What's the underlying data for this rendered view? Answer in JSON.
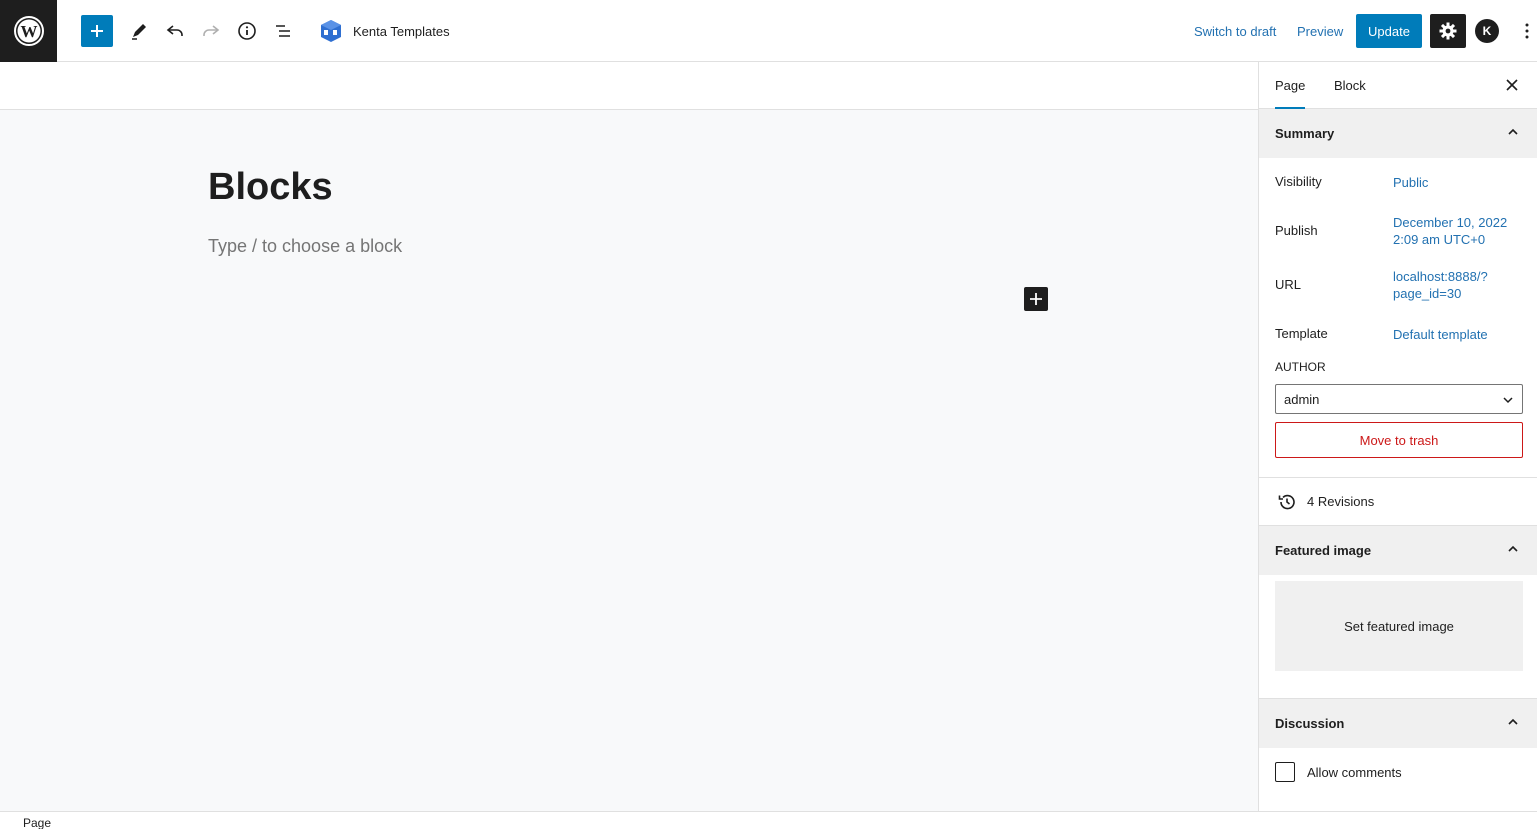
{
  "topbar": {
    "kenta_label": "Kenta Templates",
    "switch_to_draft": "Switch to draft",
    "preview": "Preview",
    "update": "Update",
    "avatar_letter": "K"
  },
  "canvas": {
    "title": "Blocks",
    "placeholder": "Type / to choose a block"
  },
  "sidebar": {
    "tabs": [
      {
        "label": "Page",
        "active": true
      },
      {
        "label": "Block",
        "active": false
      }
    ],
    "summary": {
      "heading": "Summary",
      "visibility_label": "Visibility",
      "visibility_value": "Public",
      "publish_label": "Publish",
      "publish_date": "December 10, 2022",
      "publish_time": "2:09 am UTC+0",
      "url_label": "URL",
      "url_line1": "localhost:8888/?",
      "url_line2": "page_id=30",
      "template_label": "Template",
      "template_value": "Default template",
      "author_label": "AUTHOR",
      "author_value": "admin",
      "trash": "Move to trash"
    },
    "revisions": "4 Revisions",
    "featured": {
      "heading": "Featured image",
      "set_label": "Set featured image"
    },
    "discussion": {
      "heading": "Discussion",
      "allow_comments": "Allow comments"
    }
  },
  "footer": {
    "breadcrumb": "Page"
  },
  "colors": {
    "accent": "#007cba",
    "link": "#2271b1",
    "danger": "#cc1818",
    "dark": "#1e1e1e"
  }
}
